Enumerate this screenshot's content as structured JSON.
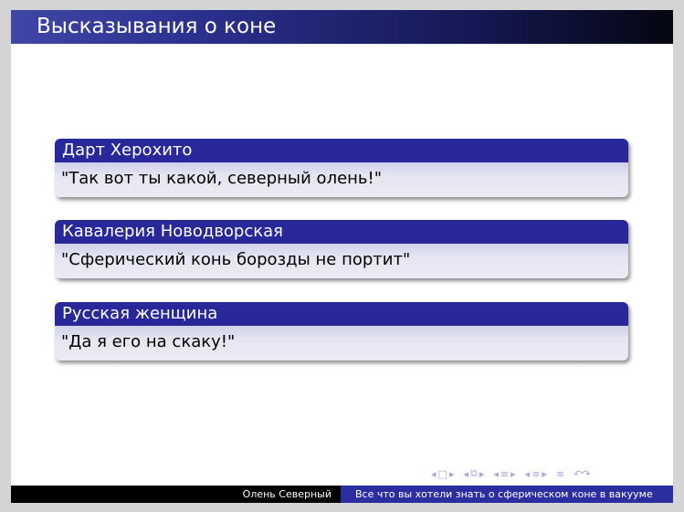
{
  "slide": {
    "title": "Высказывания о коне",
    "blocks": [
      {
        "title": "Дарт Херохито",
        "body": "\"Так вот ты какой, северный олень!\""
      },
      {
        "title": "Кавалерия Новодворская",
        "body": "\"Сферический конь борозды не портит\""
      },
      {
        "title": "Русская женщина",
        "body": "\"Да я его на скаку!\""
      }
    ]
  },
  "navigation": {
    "icons": [
      "nav-slide-icon",
      "nav-frame-icon",
      "nav-subsection-icon",
      "nav-section-icon",
      "nav-toc-icon",
      "nav-search-icon"
    ]
  },
  "footer": {
    "author": "Олень Северный",
    "short_title": "Все что вы хотели знать о сферическом коне в вакууме"
  },
  "colors": {
    "title_bar_start": "#4046a6",
    "title_bar_end": "#05060f",
    "block_title_bg": "#28289a",
    "block_body_bg": "#ebebf5",
    "footer_left_bg": "#000000",
    "footer_right_bg": "#2c2ea0"
  }
}
